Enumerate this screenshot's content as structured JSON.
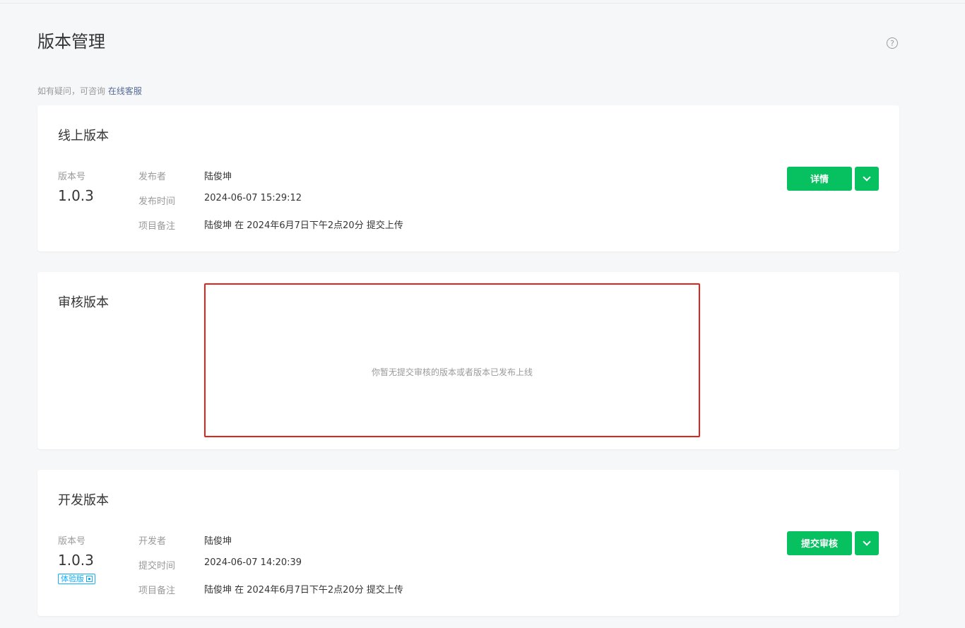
{
  "page": {
    "title": "版本管理",
    "help_icon_glyph": "?",
    "hint_text": "如有疑问，可咨询 ",
    "hint_link": "在线客服"
  },
  "online": {
    "title": "线上版本",
    "version_label": "版本号",
    "version": "1.0.3",
    "fields": [
      {
        "label": "发布者",
        "value": "陆俊坤"
      },
      {
        "label": "发布时间",
        "value": "2024-06-07 15:29:12"
      },
      {
        "label": "项目备注",
        "value": "陆俊坤 在 2024年6月7日下午2点20分 提交上传"
      }
    ],
    "primary_button": "详情"
  },
  "review": {
    "title": "审核版本",
    "empty_text": "你暂无提交审核的版本或者版本已发布上线"
  },
  "dev": {
    "title": "开发版本",
    "version_label": "版本号",
    "version": "1.0.3",
    "tag": "体验版",
    "fields": [
      {
        "label": "开发者",
        "value": "陆俊坤"
      },
      {
        "label": "提交时间",
        "value": "2024-06-07 14:20:39"
      },
      {
        "label": "项目备注",
        "value": "陆俊坤 在 2024年6月7日下午2点20分 提交上传"
      }
    ],
    "primary_button": "提交审核"
  },
  "colors": {
    "accent_green": "#07c160",
    "link": "#576b95",
    "tag_blue": "#10aeff",
    "highlight_red": "#e2231a"
  }
}
